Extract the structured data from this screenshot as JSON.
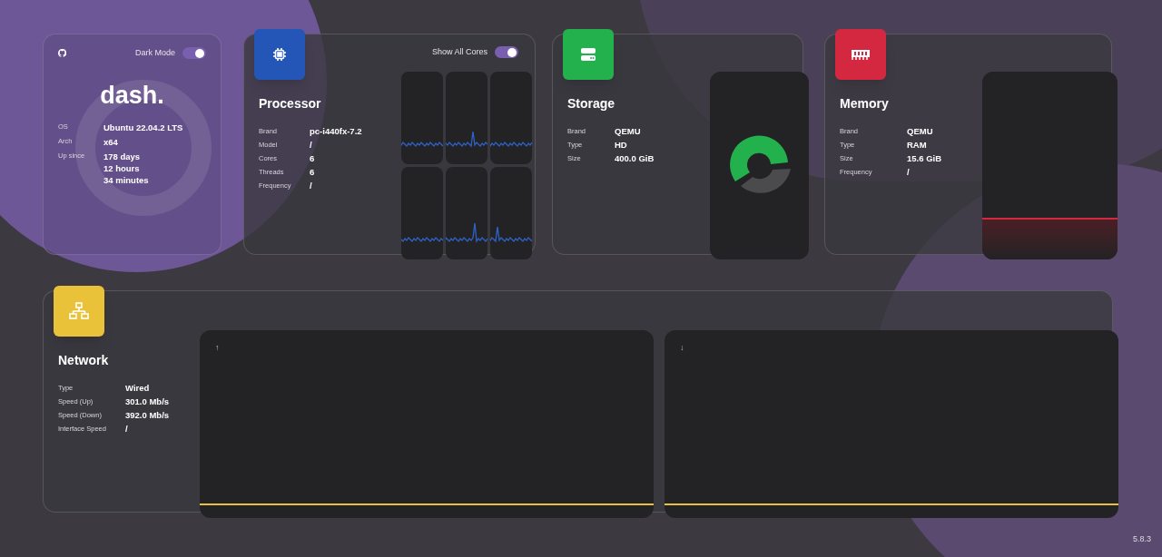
{
  "overview": {
    "dark_mode": {
      "label": "Dark Mode",
      "on": true
    },
    "logo": "dash.",
    "info": [
      {
        "label": "OS",
        "value": [
          "Ubuntu 22.04.2 LTS"
        ]
      },
      {
        "label": "Arch",
        "value": [
          "x64"
        ]
      },
      {
        "label": "Up since",
        "value": [
          "178 days",
          "12 hours",
          "34 minutes"
        ]
      }
    ]
  },
  "processor": {
    "title": "Processor",
    "toggle": {
      "label": "Show All Cores",
      "on": true
    },
    "info": [
      {
        "label": "Brand",
        "value": "pc-i440fx-7.2"
      },
      {
        "label": "Model",
        "value": "/"
      },
      {
        "label": "Cores",
        "value": "6"
      },
      {
        "label": "Threads",
        "value": "6"
      },
      {
        "label": "Frequency",
        "value": "/"
      }
    ]
  },
  "storage": {
    "title": "Storage",
    "info": [
      {
        "label": "Brand",
        "value": "QEMU"
      },
      {
        "label": "Type",
        "value": "HD"
      },
      {
        "label": "Size",
        "value": "400.0 GiB"
      }
    ]
  },
  "memory": {
    "title": "Memory",
    "info": [
      {
        "label": "Brand",
        "value": "QEMU"
      },
      {
        "label": "Type",
        "value": "RAM"
      },
      {
        "label": "Size",
        "value": "15.6 GiB"
      },
      {
        "label": "Frequency",
        "value": "/"
      }
    ]
  },
  "network": {
    "title": "Network",
    "info": [
      {
        "label": "Type",
        "value": "Wired"
      },
      {
        "label": "Speed (Up)",
        "value": "301.0 Mb/s"
      },
      {
        "label": "Speed (Down)",
        "value": "392.0 Mb/s"
      },
      {
        "label": "Interface Speed",
        "value": "/"
      }
    ],
    "graphs": [
      {
        "label": "↑"
      },
      {
        "label": "↓"
      }
    ]
  },
  "version": "5.8.3"
}
